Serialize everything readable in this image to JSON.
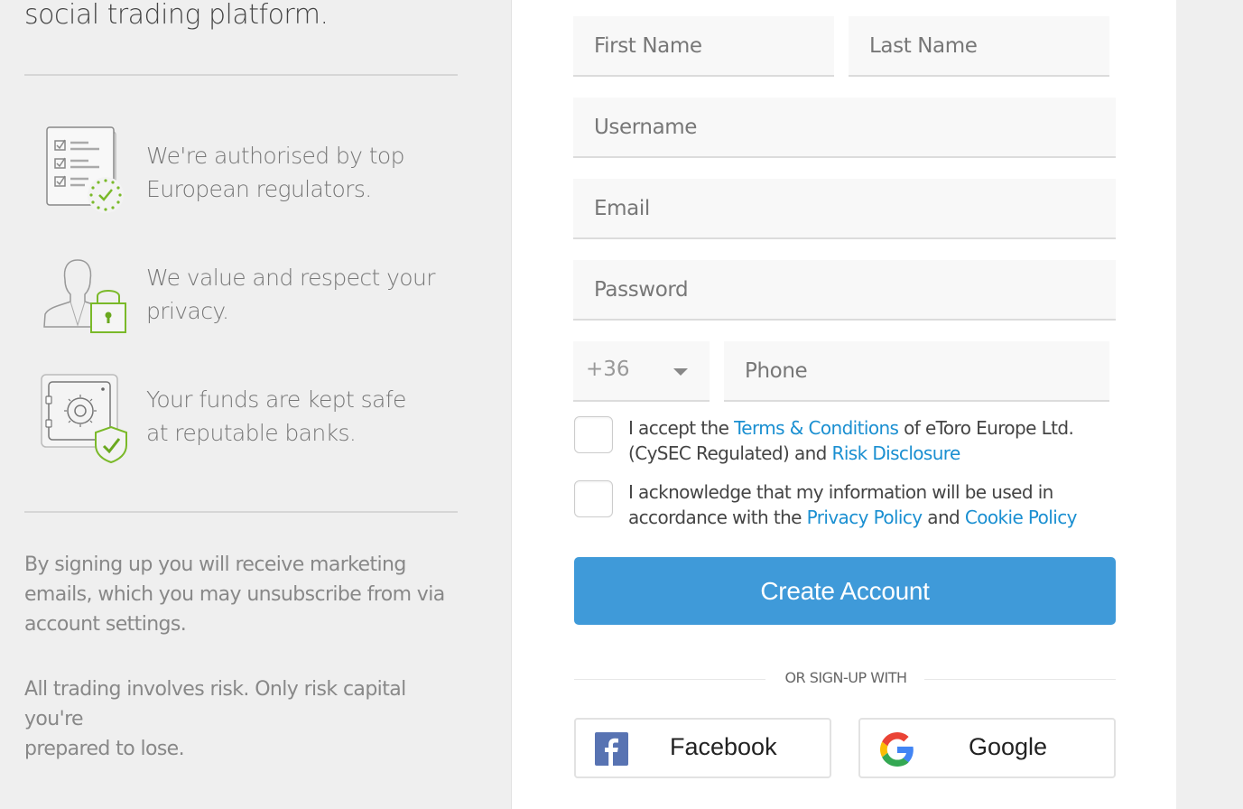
{
  "left_panel": {
    "tagline": "social trading platform.",
    "features": [
      {
        "icon": "regulation-checklist-icon",
        "line1": "We're authorised by top",
        "line2": "European regulators."
      },
      {
        "icon": "privacy-user-lock-icon",
        "line1": "We value and respect your",
        "line2": "privacy."
      },
      {
        "icon": "safe-shield-icon",
        "line1": "Your funds are kept safe",
        "line2": "at reputable banks."
      }
    ],
    "marketing_note": {
      "line1": "By signing up you will receive marketing",
      "line2": "emails, which you may unsubscribe from via",
      "line3": "account settings."
    },
    "risk_note": {
      "line1": "All trading involves risk. Only risk capital you're",
      "line2": "prepared to lose."
    }
  },
  "form": {
    "first_name": {
      "placeholder": "First Name",
      "value": ""
    },
    "last_name": {
      "placeholder": "Last Name",
      "value": ""
    },
    "username": {
      "placeholder": "Username",
      "value": ""
    },
    "email": {
      "placeholder": "Email",
      "value": ""
    },
    "password": {
      "placeholder": "Password",
      "value": ""
    },
    "country_code": {
      "selected": "+36"
    },
    "phone": {
      "placeholder": "Phone",
      "value": ""
    },
    "terms": {
      "checked": false,
      "prefix": "I accept the ",
      "link1": "Terms & Conditions",
      "middle": " of eToro Europe Ltd. (CySEC Regulated) and ",
      "link2": "Risk Disclosure"
    },
    "privacy": {
      "checked": false,
      "prefix": "I acknowledge that my information will be used in accordance with the ",
      "link1": "Privacy Policy",
      "middle": " and ",
      "link2": "Cookie Policy"
    },
    "create_button": "Create Account",
    "divider_text": "OR SIGN-UP WITH",
    "social": {
      "facebook": "Facebook",
      "google": "Google"
    }
  },
  "colors": {
    "primary": "#3f9ad9",
    "link": "#1a8fd1",
    "accent_green": "#7ab929",
    "facebook": "#5873b2"
  }
}
